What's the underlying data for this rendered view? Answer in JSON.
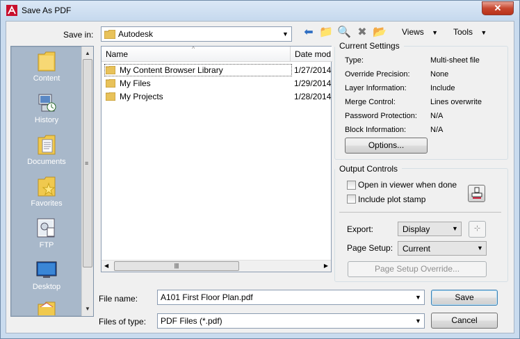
{
  "window": {
    "title": "Save As PDF",
    "close_glyph": "✕"
  },
  "toolbar": {
    "save_in_label": "Save in:",
    "save_in_value": "Autodesk",
    "views_label": "Views",
    "tools_label": "Tools"
  },
  "places": [
    {
      "label": "Content",
      "icon": "folder-icon"
    },
    {
      "label": "History",
      "icon": "history-icon"
    },
    {
      "label": "Documents",
      "icon": "documents-folder-icon"
    },
    {
      "label": "Favorites",
      "icon": "favorites-folder-icon"
    },
    {
      "label": "FTP",
      "icon": "ftp-icon"
    },
    {
      "label": "Desktop",
      "icon": "desktop-icon"
    }
  ],
  "file_list": {
    "columns": [
      "Name",
      "Date mod"
    ],
    "rows": [
      {
        "name": "My Content Browser Library",
        "date": "1/27/2014"
      },
      {
        "name": "My Files",
        "date": "1/29/2014"
      },
      {
        "name": "My Projects",
        "date": "1/28/2014"
      }
    ]
  },
  "current_settings": {
    "title": "Current Settings",
    "items": [
      {
        "key": "Type:",
        "value": "Multi-sheet file"
      },
      {
        "key": "Override Precision:",
        "value": "None"
      },
      {
        "key": "Layer Information:",
        "value": "Include"
      },
      {
        "key": "Merge Control:",
        "value": "Lines overwrite"
      },
      {
        "key": "Password Protection:",
        "value": "N/A"
      },
      {
        "key": "Block Information:",
        "value": "N/A"
      }
    ],
    "options_label": "Options..."
  },
  "output_controls": {
    "title": "Output Controls",
    "open_viewer_label": "Open in viewer when done",
    "plot_stamp_label": "Include plot stamp",
    "export_label": "Export:",
    "export_value": "Display",
    "page_setup_label": "Page Setup:",
    "page_setup_value": "Current",
    "override_label": "Page Setup Override..."
  },
  "footer": {
    "file_name_label": "File name:",
    "file_name_value": "A101 First Floor Plan.pdf",
    "file_type_label": "Files of type:",
    "file_type_value": "PDF Files (*.pdf)",
    "save_label": "Save",
    "cancel_label": "Cancel"
  }
}
